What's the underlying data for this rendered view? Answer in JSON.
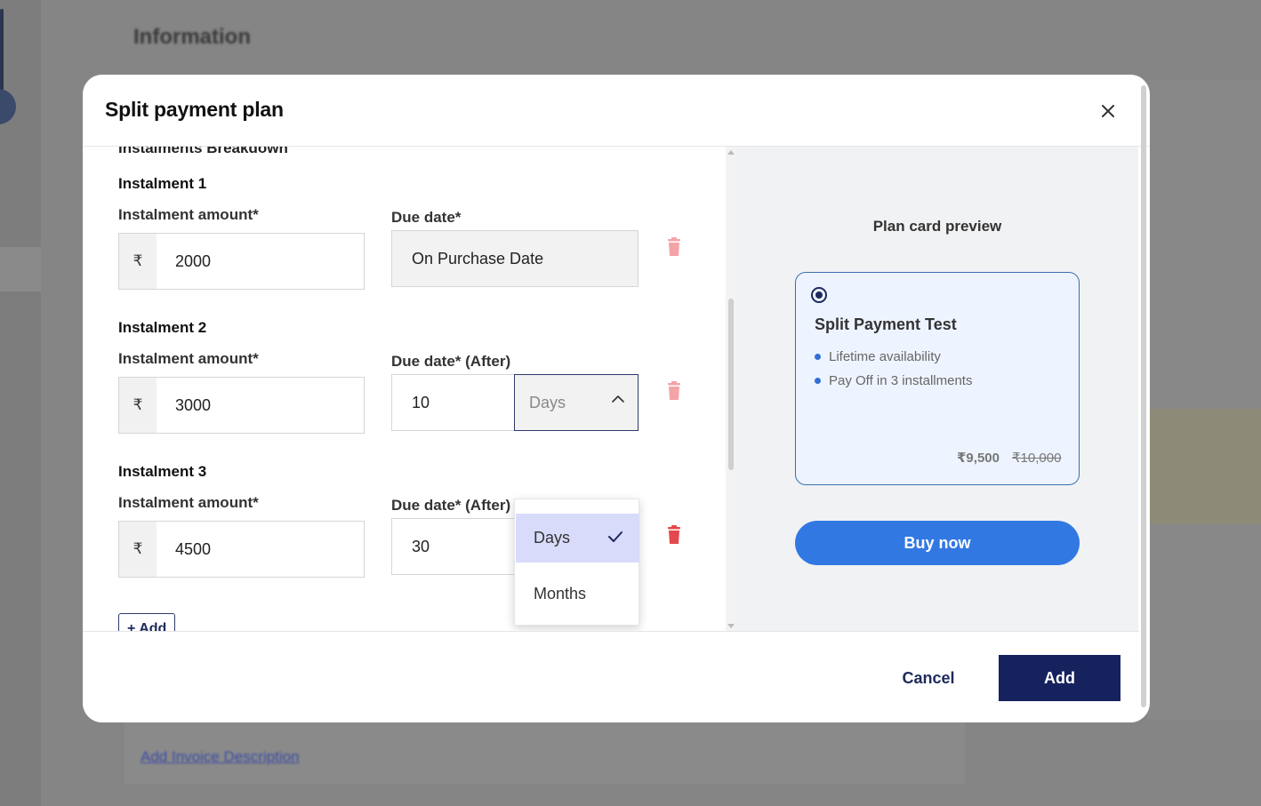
{
  "background": {
    "page_title": "Information",
    "bottom_link": "Add Invoice Description"
  },
  "modal": {
    "title": "Split payment plan",
    "section_heading": "Instalments Breakdown",
    "instalments": [
      {
        "title": "Instalment 1",
        "amount_label": "Instalment amount*",
        "currency": "₹",
        "amount": "2000",
        "due_label": "Due date*",
        "due_value": "On Purchase Date"
      },
      {
        "title": "Instalment 2",
        "amount_label": "Instalment amount*",
        "currency": "₹",
        "amount": "3000",
        "due_label": "Due date* (After)",
        "due_number": "10",
        "due_unit": "Days"
      },
      {
        "title": "Instalment 3",
        "amount_label": "Instalment amount*",
        "currency": "₹",
        "amount": "4500",
        "due_label": "Due date* (After)",
        "due_number": "30"
      }
    ],
    "add_label": "+ Add",
    "dropdown": {
      "options": [
        "Days",
        "Months"
      ],
      "selected": "Days"
    },
    "preview": {
      "title": "Plan card preview",
      "plan_name": "Split Payment Test",
      "features": [
        "Lifetime availability",
        "Pay Off in 3 installments"
      ],
      "price": "₹9,500",
      "mrp": "₹10,000",
      "buy_label": "Buy now"
    },
    "footer": {
      "cancel_label": "Cancel",
      "submit_label": "Add"
    }
  },
  "colors": {
    "primary_navy": "#16225e",
    "buy_blue": "#3278e3",
    "trash_red": "#e5484d",
    "dropdown_selected": "#d9dbfb"
  }
}
